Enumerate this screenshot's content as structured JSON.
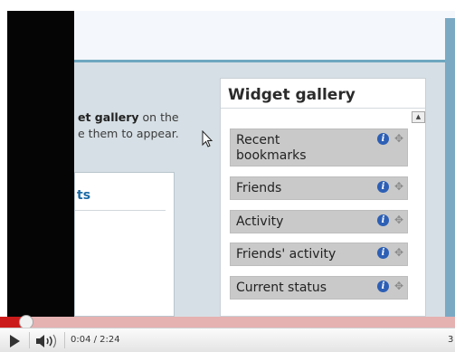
{
  "page": {
    "intro_bold": "et gallery",
    "intro_line1_rest": " on the",
    "intro_line2": "e them to appear.",
    "left_panel_title": "ts"
  },
  "gallery": {
    "title": "Widget gallery",
    "widgets": [
      {
        "label": "Recent bookmarks",
        "line1": "Recent",
        "line2": "bookmarks"
      },
      {
        "label": "Friends"
      },
      {
        "label": "Activity"
      },
      {
        "label": "Friends' activity"
      },
      {
        "label": "Current status"
      }
    ]
  },
  "player": {
    "progress": 0.03,
    "time_display": "0:04 / 2:24",
    "right_edge_text": "3"
  },
  "colors": {
    "progress_played": "#cc1b1b",
    "progress_track": "#e6b1b1",
    "info_icon": "#2d5fb5",
    "widget_bg": "#c9c9c9",
    "link_blue": "#1a6aa5"
  }
}
